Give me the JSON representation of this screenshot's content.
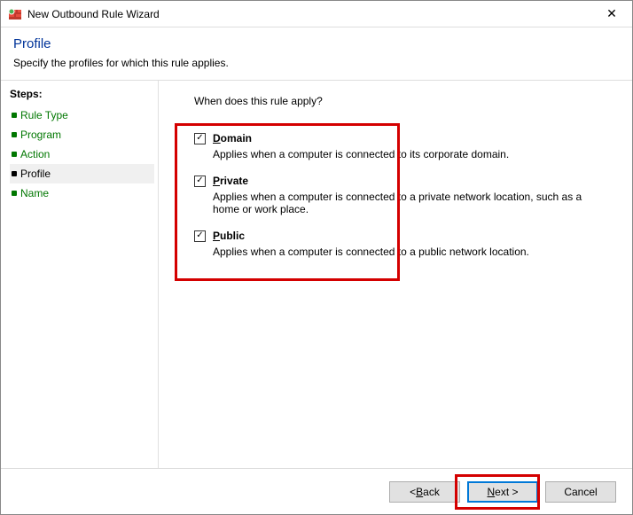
{
  "window": {
    "title": "New Outbound Rule Wizard"
  },
  "header": {
    "title": "Profile",
    "description": "Specify the profiles for which this rule applies."
  },
  "sidebar": {
    "title": "Steps:",
    "items": [
      {
        "label": "Rule Type",
        "active": false
      },
      {
        "label": "Program",
        "active": false
      },
      {
        "label": "Action",
        "active": false
      },
      {
        "label": "Profile",
        "active": true
      },
      {
        "label": "Name",
        "active": false
      }
    ]
  },
  "content": {
    "prompt": "When does this rule apply?",
    "options": [
      {
        "mnemonic": "D",
        "rest": "omain",
        "checked": true,
        "desc": "Applies when a computer is connected to its corporate domain."
      },
      {
        "mnemonic": "P",
        "rest": "rivate",
        "checked": true,
        "desc": "Applies when a computer is connected to a private network location, such as a home or work place."
      },
      {
        "mnemonic": "P",
        "rest": "ublic",
        "checked": true,
        "desc": "Applies when a computer is connected to a public network location."
      }
    ]
  },
  "footer": {
    "back": {
      "pre": "< ",
      "mnemonic": "B",
      "rest": "ack"
    },
    "next": {
      "mnemonic": "N",
      "rest": "ext >"
    },
    "cancel": "Cancel"
  }
}
